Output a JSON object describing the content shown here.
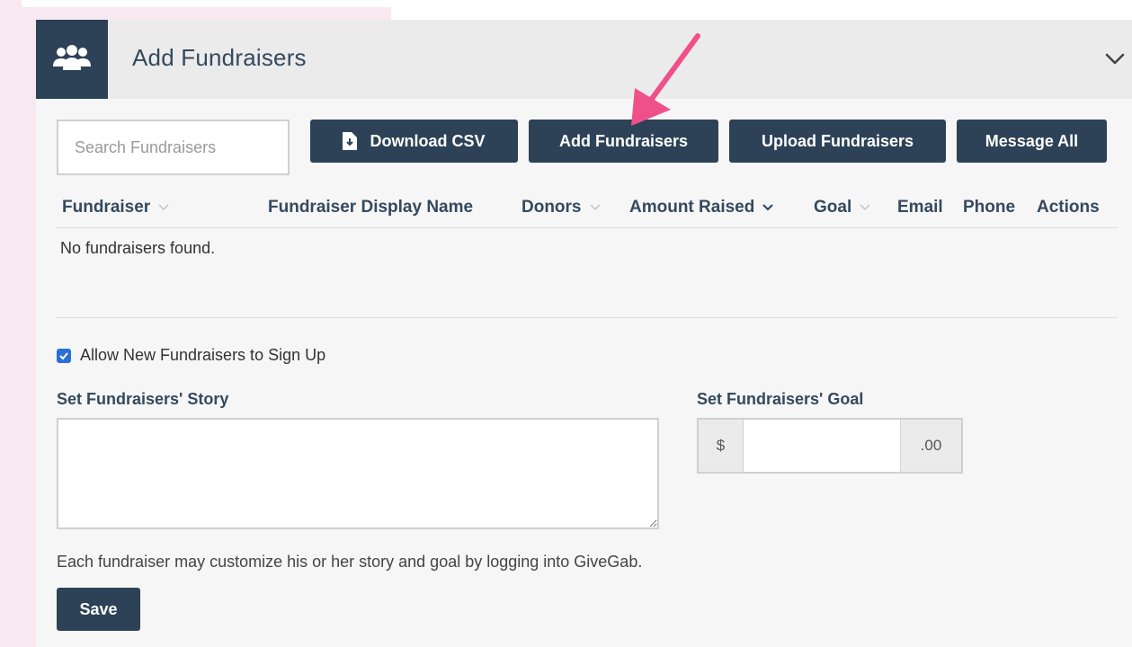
{
  "panel": {
    "title": "Add Fundraisers",
    "icon": "group-icon",
    "accent_color": "#2d4257",
    "arrow_color": "#f0508a"
  },
  "toolbar": {
    "search_placeholder": "Search Fundraisers",
    "download_csv_label": "Download CSV",
    "add_fundraisers_label": "Add Fundraisers",
    "upload_fundraisers_label": "Upload Fundraisers",
    "message_all_label": "Message All"
  },
  "table": {
    "columns": [
      {
        "label": "Fundraiser",
        "sortable": true,
        "sorted": false
      },
      {
        "label": "Fundraiser Display Name",
        "sortable": false
      },
      {
        "label": "Donors",
        "sortable": true,
        "sorted": false
      },
      {
        "label": "Amount Raised",
        "sortable": true,
        "sorted": true
      },
      {
        "label": "Goal",
        "sortable": true,
        "sorted": false
      },
      {
        "label": "Email",
        "sortable": false
      },
      {
        "label": "Phone",
        "sortable": false
      },
      {
        "label": "Actions",
        "sortable": false
      }
    ],
    "empty_message": "No fundraisers found."
  },
  "settings": {
    "allow_signup_label": "Allow New Fundraisers to Sign Up",
    "allow_signup_checked": true,
    "story_label": "Set Fundraisers' Story",
    "story_value": "",
    "goal_label": "Set Fundraisers' Goal",
    "goal_prefix": "$",
    "goal_value": "",
    "goal_suffix": ".00",
    "help_text": "Each fundraiser may customize his or her story and goal by logging into GiveGab.",
    "save_label": "Save"
  }
}
